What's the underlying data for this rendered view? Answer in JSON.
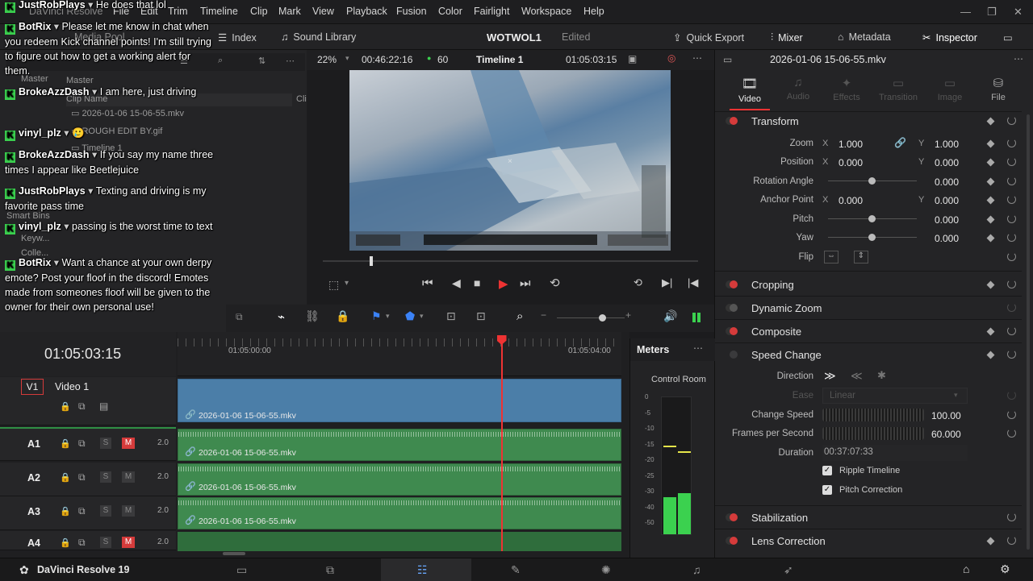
{
  "menu": {
    "app_label": "DaVinci Resolve",
    "items": [
      "File",
      "Edit",
      "Trim",
      "Timeline",
      "Clip",
      "Mark",
      "View",
      "Playback",
      "Fusion",
      "Color",
      "Fairlight",
      "Workspace",
      "Help"
    ]
  },
  "toolbar": {
    "media_pool": "Media Pool",
    "index": "Index",
    "sound_library": "Sound Library",
    "project_title": "WOTWOL1",
    "project_status": "Edited",
    "quick_export": "Quick Export",
    "mixer": "Mixer",
    "metadata": "Metadata",
    "inspector": "Inspector"
  },
  "media_pool": {
    "master": "Master",
    "master2": "Master",
    "col_clip_name": "Clip Name",
    "col_clip": "Clip",
    "clips": [
      "2026-01-06 15-06-55.mkv",
      "ROUGH EDIT BY.gif",
      "Timeline 1"
    ],
    "smart_bins": "Smart Bins",
    "keywords": "Keyw...",
    "collections": "Colle..."
  },
  "viewer": {
    "zoom": "22%",
    "duration": "00:46:22:16",
    "fps": "60",
    "timeline_name": "Timeline 1",
    "timecode": "01:05:03:15",
    "playhead_fraction": 0.06
  },
  "inspector": {
    "clip_name": "2026-01-06 15-06-55.mkv",
    "tabs": [
      "Video",
      "Audio",
      "Effects",
      "Transition",
      "Image",
      "File"
    ],
    "transform": {
      "title": "Transform",
      "zoom_label": "Zoom",
      "zoom_x": "1.000",
      "zoom_y": "1.000",
      "position_label": "Position",
      "position_x": "0.000",
      "position_y": "0.000",
      "rotation_label": "Rotation Angle",
      "rotation": "0.000",
      "anchor_label": "Anchor Point",
      "anchor_x": "0.000",
      "anchor_y": "0.000",
      "pitch_label": "Pitch",
      "pitch": "0.000",
      "yaw_label": "Yaw",
      "yaw": "0.000",
      "flip_label": "Flip",
      "x_axis": "X",
      "y_axis": "Y"
    },
    "cropping": "Cropping",
    "dynamic_zoom": "Dynamic Zoom",
    "composite": "Composite",
    "speed_change": {
      "title": "Speed Change",
      "direction_label": "Direction",
      "ease_label": "Ease",
      "ease_value": "Linear",
      "change_speed_label": "Change Speed",
      "change_speed": "100.00",
      "fps_label": "Frames per Second",
      "fps": "60.000",
      "duration_label": "Duration",
      "duration": "00:37:07:33",
      "ripple_timeline": "Ripple Timeline",
      "pitch_correction": "Pitch Correction"
    },
    "stabilization": "Stabilization",
    "lens_correction": "Lens Correction"
  },
  "timeline": {
    "timecode": "01:05:03:15",
    "ruler_start": "01:05:00:00",
    "ruler_end": "01:05:04:00",
    "playhead_fraction": 0.73,
    "tracks": [
      {
        "id": "V1",
        "name": "Video 1",
        "clip": "2026-01-06 15-06-55.mkv"
      },
      {
        "id": "A1",
        "level": "2.0",
        "clip": "2026-01-06 15-06-55.mkv"
      },
      {
        "id": "A2",
        "level": "2.0",
        "clip": "2026-01-06 15-06-55.mkv"
      },
      {
        "id": "A3",
        "level": "2.0",
        "clip": "2026-01-06 15-06-55.mkv"
      },
      {
        "id": "A4",
        "level": "2.0"
      }
    ],
    "solo": "S",
    "mute": "M"
  },
  "meters": {
    "title": "Meters",
    "control_room": "Control Room",
    "scale": [
      "0",
      "-5",
      "-10",
      "-15",
      "-20",
      "-25",
      "-30",
      "-40",
      "-50"
    ],
    "level_left": 0.72,
    "level_right": 0.75
  },
  "bottom": {
    "app_name": "DaVinci Resolve 19"
  },
  "chat": [
    {
      "user": "JustRobPlays",
      "text": "He does that lol"
    },
    {
      "user": "BotRix",
      "text": "Please let me know in chat when you redeem Kick channel points! I'm still trying to figure out how to get a working alert for them."
    },
    {
      "user": "BrokeAzzDash",
      "text": "I am here, just driving"
    },
    {
      "user": "vinyl_plz",
      "text": "🥲"
    },
    {
      "user": "BrokeAzzDash",
      "text": "If you say my name three times I appear like Beetlejuice"
    },
    {
      "user": "JustRobPlays",
      "text": "Texting and driving is my favorite pass time"
    },
    {
      "user": "vinyl_plz",
      "text": "passing is the worst time to text"
    },
    {
      "user": "BotRix",
      "text": "Want a chance at your own derpy emote? Post your floof in the discord! Emotes made from someones floof will be given to the owner for their own personal use!"
    }
  ],
  "colors": {
    "accent_red": "#d53b3b",
    "video_clip": "#4b7ea8",
    "audio_clip": "#3f8a4f",
    "kick_green": "#3bd14f"
  }
}
